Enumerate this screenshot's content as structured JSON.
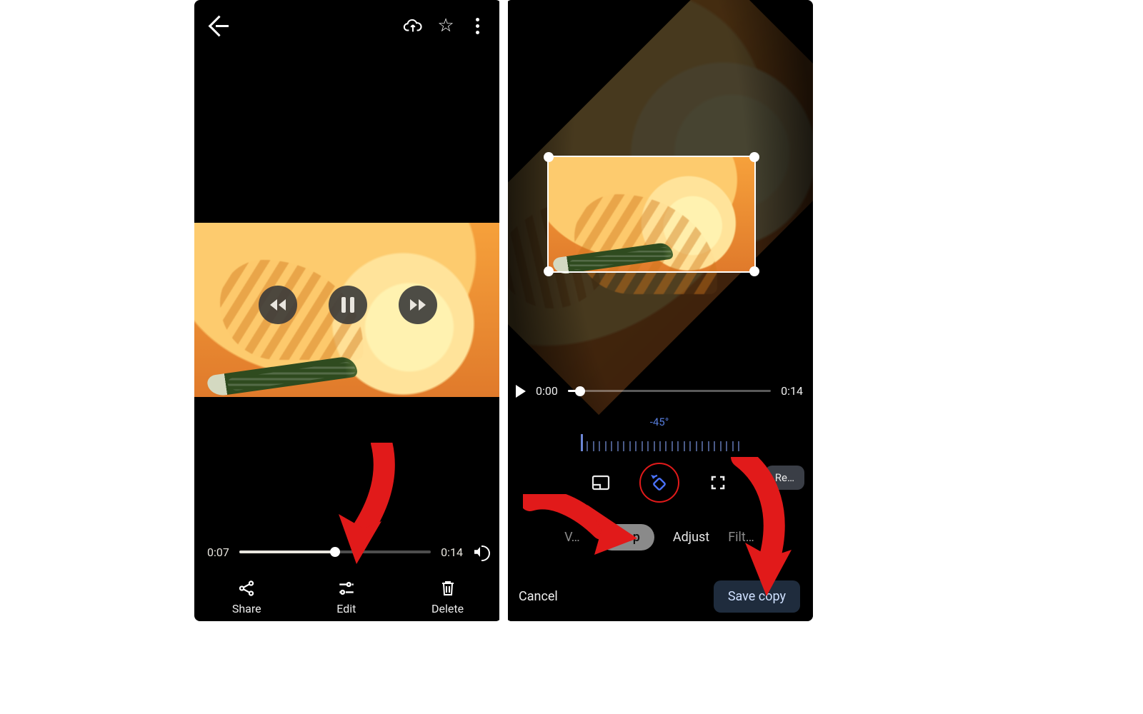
{
  "left": {
    "seek": {
      "current": "0:07",
      "duration": "0:14",
      "progress_pct": 50
    },
    "actions": {
      "share": "Share",
      "edit": "Edit",
      "delete": "Delete"
    },
    "topbar": {
      "back": "back",
      "cloud": "cloud-upload",
      "star": "star",
      "more": "more"
    }
  },
  "right": {
    "play": {
      "current": "0:00",
      "duration": "0:14",
      "progress_pct": 6
    },
    "angle": {
      "readout": "-45°",
      "value_deg": -45
    },
    "reset_chip": "Re…",
    "tabs": {
      "left_faded": "V…",
      "crop": "Crop",
      "adjust": "Adjust",
      "right_faded": "Filt…"
    },
    "bottom": {
      "cancel": "Cancel",
      "save": "Save copy"
    },
    "tools": {
      "aspect": "aspect-ratio",
      "rotate": "rotate-ccw",
      "expand": "fullscreen"
    }
  },
  "colors": {
    "arrow": "#e11a1a",
    "ring": "#e11a1a",
    "accent_blue": "#4b74ff"
  }
}
